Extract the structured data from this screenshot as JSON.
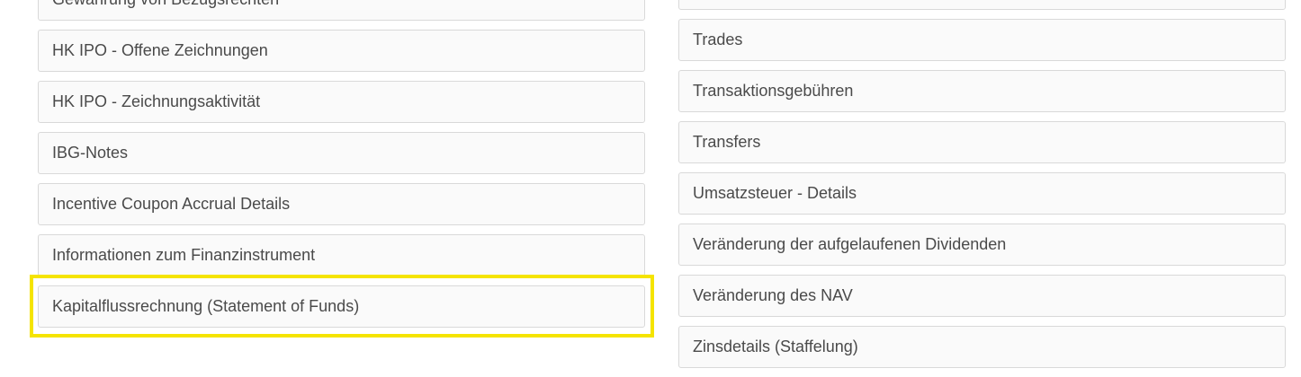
{
  "left_items": [
    {
      "label": "Gewährung von Bezugsrechten"
    },
    {
      "label": "HK IPO - Offene Zeichnungen"
    },
    {
      "label": "HK IPO - Zeichnungsaktivität"
    },
    {
      "label": "IBG-Notes"
    },
    {
      "label": "Incentive Coupon Accrual Details"
    },
    {
      "label": "Informationen zum Finanzinstrument"
    },
    {
      "label": "Kapitalflussrechnung (Statement of Funds)"
    }
  ],
  "right_items": [
    {
      "label": ""
    },
    {
      "label": "Trades"
    },
    {
      "label": "Transaktionsgebühren"
    },
    {
      "label": "Transfers"
    },
    {
      "label": "Umsatzsteuer - Details"
    },
    {
      "label": "Veränderung der aufgelaufenen Dividenden"
    },
    {
      "label": "Veränderung des NAV"
    },
    {
      "label": "Zinsdetails (Staffelung)"
    }
  ],
  "highlight": {
    "color": "#f5e400",
    "target": "Kapitalflussrechnung (Statement of Funds)"
  },
  "colors": {
    "item_background": "#fafafa",
    "item_border": "#d9d9d9",
    "text": "#4a4a4a"
  }
}
